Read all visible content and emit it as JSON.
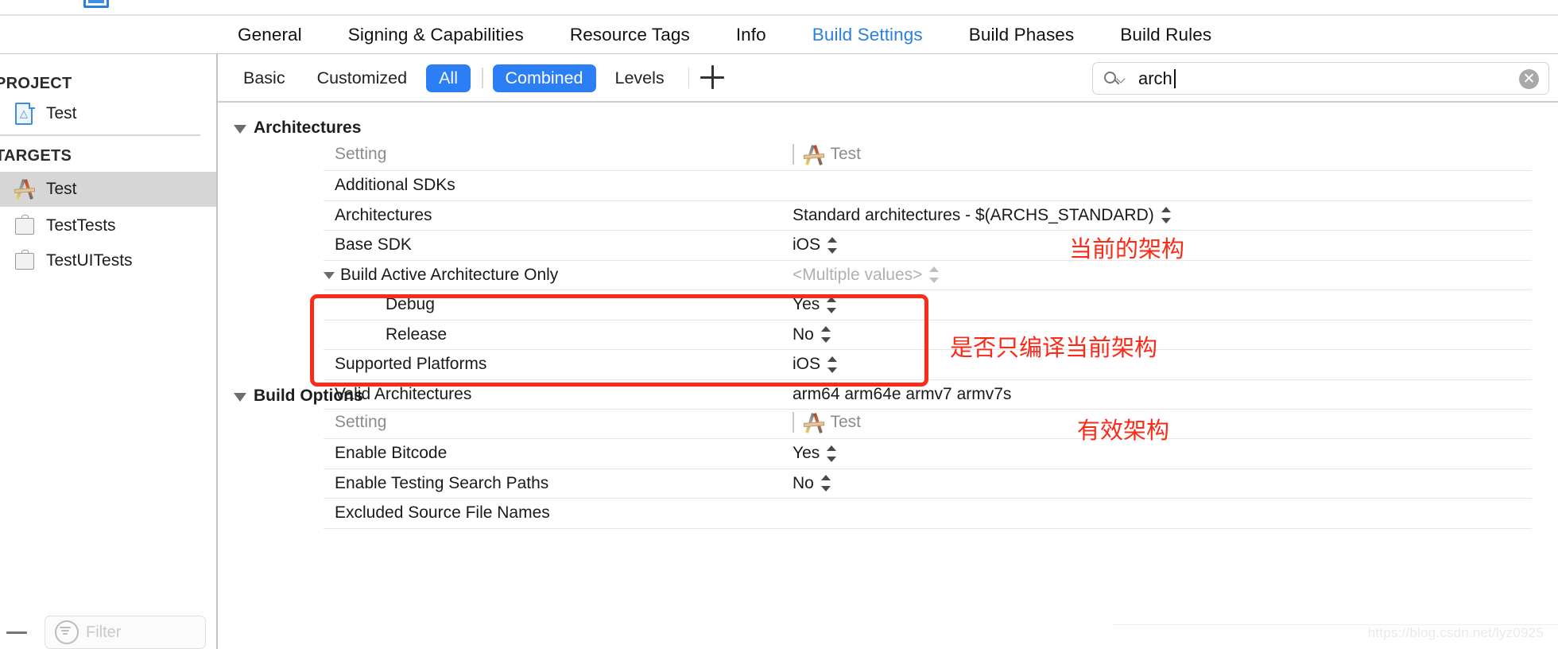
{
  "window": {
    "tabs": [
      {
        "label": "General",
        "active": false
      },
      {
        "label": "Signing & Capabilities",
        "active": false
      },
      {
        "label": "Resource Tags",
        "active": false
      },
      {
        "label": "Info",
        "active": false
      },
      {
        "label": "Build Settings",
        "active": true
      },
      {
        "label": "Build Phases",
        "active": false
      },
      {
        "label": "Build Rules",
        "active": false
      }
    ]
  },
  "sidebar": {
    "project_group_label": "PROJECT",
    "targets_group_label": "TARGETS",
    "project_items": [
      {
        "label": "Test",
        "icon": "app-document-icon"
      }
    ],
    "target_items": [
      {
        "label": "Test",
        "icon": "xcode-target-icon",
        "selected": true
      },
      {
        "label": "TestTests",
        "icon": "test-bundle-icon",
        "selected": false
      },
      {
        "label": "TestUITests",
        "icon": "test-bundle-icon",
        "selected": false
      }
    ],
    "filter_placeholder": "Filter",
    "remove_button_label": "—"
  },
  "toolbar": {
    "segments": [
      {
        "label": "Basic",
        "active": false
      },
      {
        "label": "Customized",
        "active": false
      },
      {
        "label": "All",
        "active": true
      },
      {
        "label": "Combined",
        "active": true
      },
      {
        "label": "Levels",
        "active": false
      }
    ],
    "add_button_label": "+",
    "search": {
      "value": "arch",
      "placeholder": "",
      "clear_label": "✕"
    }
  },
  "sections": [
    {
      "title": "Architectures",
      "columns": {
        "setting": "Setting",
        "target": "Test"
      },
      "rows": [
        {
          "name": "Additional SDKs",
          "value": "",
          "stepper": false,
          "indent": 0
        },
        {
          "name": "Architectures",
          "value": "Standard architectures  -  $(ARCHS_STANDARD)",
          "stepper": true,
          "indent": 0
        },
        {
          "name": "Base SDK",
          "value": "iOS",
          "stepper": true,
          "indent": 0
        },
        {
          "name": "Build Active Architecture Only",
          "value": "<Multiple values>",
          "stepper": true,
          "muted": true,
          "indent": 0,
          "expanded": true
        },
        {
          "name": "Debug",
          "value": "Yes",
          "stepper": true,
          "indent": 1
        },
        {
          "name": "Release",
          "value": "No",
          "stepper": true,
          "indent": 1
        },
        {
          "name": "Supported Platforms",
          "value": "iOS",
          "stepper": true,
          "indent": 0
        },
        {
          "name": "Valid Architectures",
          "value": "arm64 arm64e armv7 armv7s",
          "stepper": false,
          "indent": 0
        }
      ]
    },
    {
      "title": "Build Options",
      "columns": {
        "setting": "Setting",
        "target": "Test"
      },
      "rows": [
        {
          "name": "Enable Bitcode",
          "value": "Yes",
          "stepper": true,
          "indent": 0
        },
        {
          "name": "Enable Testing Search Paths",
          "value": "No",
          "stepper": true,
          "indent": 0
        },
        {
          "name": "Excluded Source File Names",
          "value": "",
          "stepper": false,
          "indent": 0
        }
      ]
    }
  ],
  "annotations": [
    {
      "id": "a1",
      "text": "当前的架构"
    },
    {
      "id": "a2",
      "text": "是否只编译当前架构"
    },
    {
      "id": "a3",
      "text": "有效架构"
    }
  ],
  "watermark": "https://blog.csdn.net/lyz0925",
  "colors": {
    "accent_blue": "#2b7ef4",
    "tab_active": "#2b7fe0",
    "annotation_red": "#fb2a17",
    "selected_row_bg": "#d6d6d6"
  }
}
